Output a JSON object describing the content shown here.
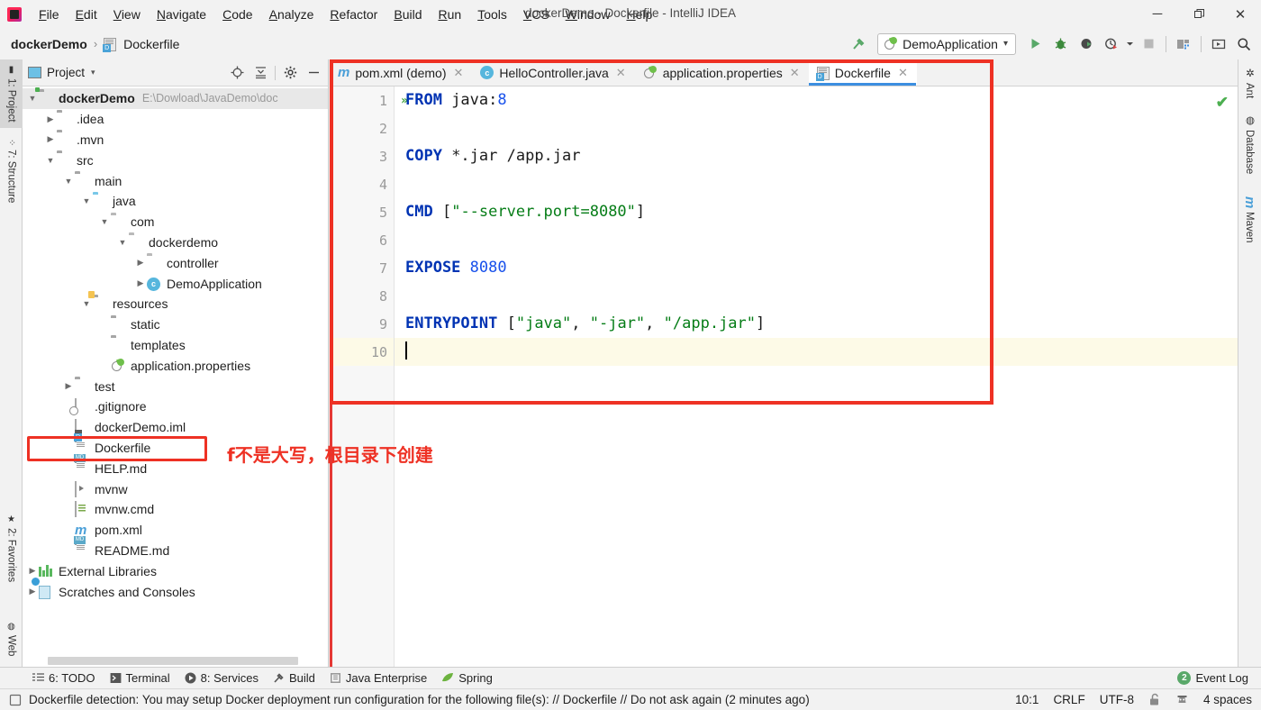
{
  "window": {
    "title": "dockerDemo - Dockerfile - IntelliJ IDEA",
    "minimize": "─",
    "maximize": "❐",
    "close": "✕"
  },
  "menubar": {
    "items": [
      {
        "label": "File",
        "mnemonic": "F"
      },
      {
        "label": "Edit",
        "mnemonic": "E"
      },
      {
        "label": "View",
        "mnemonic": "V"
      },
      {
        "label": "Navigate",
        "mnemonic": "N"
      },
      {
        "label": "Code",
        "mnemonic": "C"
      },
      {
        "label": "Analyze",
        "mnemonic": "A"
      },
      {
        "label": "Refactor",
        "mnemonic": "R"
      },
      {
        "label": "Build",
        "mnemonic": "B"
      },
      {
        "label": "Run",
        "mnemonic": "R"
      },
      {
        "label": "Tools",
        "mnemonic": "T"
      },
      {
        "label": "VCS",
        "mnemonic": "V"
      },
      {
        "label": "Window",
        "mnemonic": "W"
      },
      {
        "label": "Help",
        "mnemonic": "H"
      }
    ]
  },
  "navbar": {
    "breadcrumb": [
      "dockerDemo",
      "Dockerfile"
    ],
    "separator": "›",
    "run_config": "DemoApplication",
    "run_config_dropdown": "▾",
    "buttons": {
      "build": "build-hammer-icon",
      "run": "run-icon",
      "debug": "debug-icon",
      "run_with_coverage": "run-coverage-icon",
      "profile": "profiler-icon",
      "stop": "stop-icon",
      "project_structure": "project-structure-icon",
      "update": "update-icon",
      "search": "search-everywhere-icon"
    }
  },
  "tool_stripes": {
    "left": [
      {
        "label": "1: Project",
        "active": true
      },
      {
        "label": "7: Structure",
        "active": false
      },
      {
        "label": "2: Favorites",
        "active": false
      },
      {
        "label": "Web",
        "active": false
      }
    ],
    "right": [
      {
        "label": "Ant"
      },
      {
        "label": "Database"
      },
      {
        "label": "Maven"
      }
    ]
  },
  "project_panel": {
    "title": "Project",
    "dropdown": "▾",
    "actions": [
      "locate-icon",
      "collapse-all-icon",
      "settings-gear-icon",
      "hide-icon"
    ],
    "tree": [
      {
        "indent": 0,
        "arrow": "down",
        "icon": "folder-project",
        "label": "dockerDemo",
        "bold": true,
        "path": "E:\\Dowload\\JavaDemo\\doc",
        "selected": true
      },
      {
        "indent": 1,
        "arrow": "right",
        "icon": "folder",
        "label": ".idea"
      },
      {
        "indent": 1,
        "arrow": "right",
        "icon": "folder",
        "label": ".mvn"
      },
      {
        "indent": 1,
        "arrow": "down",
        "icon": "folder",
        "label": "src"
      },
      {
        "indent": 2,
        "arrow": "down",
        "icon": "folder",
        "label": "main"
      },
      {
        "indent": 3,
        "arrow": "down",
        "icon": "folder-source",
        "label": "java"
      },
      {
        "indent": 4,
        "arrow": "down",
        "icon": "folder-package",
        "label": "com"
      },
      {
        "indent": 5,
        "arrow": "down",
        "icon": "folder-package",
        "label": "dockerdemo"
      },
      {
        "indent": 6,
        "arrow": "right",
        "icon": "folder-package",
        "label": "controller"
      },
      {
        "indent": 6,
        "arrow": "right",
        "icon": "spring-class",
        "label": "DemoApplication"
      },
      {
        "indent": 3,
        "arrow": "down",
        "icon": "folder-resource",
        "label": "resources"
      },
      {
        "indent": 4,
        "arrow": "none",
        "icon": "folder",
        "label": "static"
      },
      {
        "indent": 4,
        "arrow": "none",
        "icon": "folder",
        "label": "templates"
      },
      {
        "indent": 4,
        "arrow": "none",
        "icon": "spring-props",
        "label": "application.properties"
      },
      {
        "indent": 2,
        "arrow": "right",
        "icon": "folder",
        "label": "test"
      },
      {
        "indent": 2,
        "arrow": "none",
        "icon": "gitignore",
        "label": ".gitignore"
      },
      {
        "indent": 2,
        "arrow": "none",
        "icon": "iml",
        "label": "dockerDemo.iml"
      },
      {
        "indent": 2,
        "arrow": "none",
        "icon": "dockerfile",
        "label": "Dockerfile",
        "highlighted": true
      },
      {
        "indent": 2,
        "arrow": "none",
        "icon": "markdown",
        "label": "HELP.md"
      },
      {
        "indent": 2,
        "arrow": "none",
        "icon": "script",
        "label": "mvnw"
      },
      {
        "indent": 2,
        "arrow": "none",
        "icon": "cmd",
        "label": "mvnw.cmd"
      },
      {
        "indent": 2,
        "arrow": "none",
        "icon": "maven-xml",
        "label": "pom.xml"
      },
      {
        "indent": 2,
        "arrow": "none",
        "icon": "markdown",
        "label": "README.md"
      },
      {
        "indent": 0,
        "arrow": "right",
        "icon": "external-libs",
        "label": "External Libraries"
      },
      {
        "indent": 0,
        "arrow": "right",
        "icon": "scratches",
        "label": "Scratches and Consoles"
      }
    ]
  },
  "annotation": {
    "text": "f不是大写，根目录下创建",
    "color": "#ee3124"
  },
  "editor": {
    "tabs": [
      {
        "label": "pom.xml (demo)",
        "icon": "maven-xml",
        "active": false,
        "close": "✕"
      },
      {
        "label": "HelloController.java",
        "icon": "java-class",
        "active": false,
        "close": "✕"
      },
      {
        "label": "application.properties",
        "icon": "spring-props",
        "active": false,
        "close": "✕"
      },
      {
        "label": "Dockerfile",
        "icon": "dockerfile",
        "active": true,
        "close": "✕"
      }
    ],
    "inspection_status": "✔",
    "lines": [
      {
        "n": "1",
        "runmark": "»",
        "current": false,
        "tokens": [
          {
            "t": "FROM",
            "c": "kw"
          },
          {
            "t": " java:",
            "c": "plain"
          },
          {
            "t": "8",
            "c": "num"
          }
        ]
      },
      {
        "n": "2",
        "runmark": "",
        "current": false,
        "tokens": []
      },
      {
        "n": "3",
        "runmark": "",
        "current": false,
        "tokens": [
          {
            "t": "COPY",
            "c": "kw"
          },
          {
            "t": " *.jar ",
            "c": "plain"
          },
          {
            "t": "/app.jar",
            "c": "plain"
          }
        ]
      },
      {
        "n": "4",
        "runmark": "",
        "current": false,
        "tokens": []
      },
      {
        "n": "5",
        "runmark": "",
        "current": false,
        "tokens": [
          {
            "t": "CMD",
            "c": "kw"
          },
          {
            "t": " [",
            "c": "punct"
          },
          {
            "t": "\"--server.port=8080\"",
            "c": "str"
          },
          {
            "t": "]",
            "c": "punct"
          }
        ]
      },
      {
        "n": "6",
        "runmark": "",
        "current": false,
        "tokens": []
      },
      {
        "n": "7",
        "runmark": "",
        "current": false,
        "tokens": [
          {
            "t": "EXPOSE",
            "c": "kw"
          },
          {
            "t": " ",
            "c": "plain"
          },
          {
            "t": "8080",
            "c": "num"
          }
        ]
      },
      {
        "n": "8",
        "runmark": "",
        "current": false,
        "tokens": []
      },
      {
        "n": "9",
        "runmark": "",
        "current": false,
        "tokens": [
          {
            "t": "ENTRYPOINT",
            "c": "kw"
          },
          {
            "t": " [",
            "c": "punct"
          },
          {
            "t": "\"java\"",
            "c": "str"
          },
          {
            "t": ", ",
            "c": "punct"
          },
          {
            "t": "\"-jar\"",
            "c": "str"
          },
          {
            "t": ", ",
            "c": "punct"
          },
          {
            "t": "\"/app.jar\"",
            "c": "str"
          },
          {
            "t": "]",
            "c": "punct"
          }
        ]
      },
      {
        "n": "10",
        "runmark": "",
        "current": true,
        "caret": true,
        "tokens": []
      }
    ]
  },
  "bottom_bar": {
    "items": [
      {
        "label": "6: TODO",
        "mnemonic": "6",
        "icon": "todo-icon"
      },
      {
        "label": "Terminal",
        "mnemonic": "",
        "icon": "terminal-icon"
      },
      {
        "label": "8: Services",
        "mnemonic": "8",
        "icon": "services-icon"
      },
      {
        "label": "Build",
        "mnemonic": "",
        "icon": "build-hammer-icon"
      },
      {
        "label": "Java Enterprise",
        "mnemonic": "",
        "icon": "java-enterprise-icon"
      },
      {
        "label": "Spring",
        "mnemonic": "",
        "icon": "spring-leaf-icon"
      }
    ],
    "event_log": {
      "label": "Event Log",
      "count": "2"
    }
  },
  "status_bar": {
    "message": "Dockerfile detection: You may setup Docker deployment run configuration for the following file(s): // Dockerfile // Do not ask again (2 minutes ago)",
    "caret_position": "10:1",
    "line_separator": "CRLF",
    "encoding": "UTF-8",
    "lock_icon": "unlocked-icon",
    "git_icon": "git-branch-icon",
    "indent": "4 spaces"
  }
}
